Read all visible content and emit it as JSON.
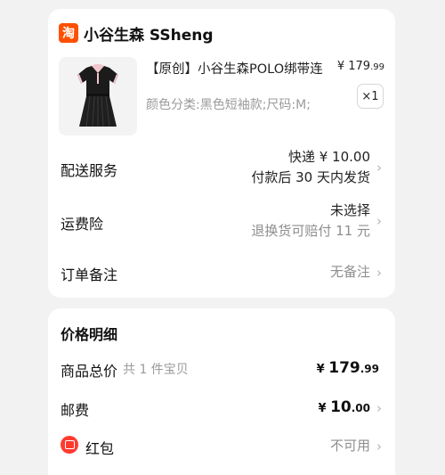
{
  "shop": {
    "logo_glyph": "淘",
    "name": "小谷生森 SSheng"
  },
  "product": {
    "title": "【原创】小谷生森POLO绑带连",
    "price_currency": "¥",
    "price_int": "179",
    "price_dec": ".99",
    "sku": "颜色分类:黑色短袖款;尺码:M;",
    "quantity": "×1",
    "image_icon": "dress-icon"
  },
  "delivery": {
    "label": "配送服务",
    "line1": "快递 ¥ 10.00",
    "line2": "付款后 30 天内发货"
  },
  "insurance": {
    "label": "运费险",
    "line1": "未选择",
    "line2": "退换货可赔付 11 元"
  },
  "remark": {
    "label": "订单备注",
    "value": "无备注"
  },
  "price_detail": {
    "title": "价格明细",
    "goods_total": {
      "label": "商品总价",
      "note": "共 1 件宝贝",
      "currency": "¥",
      "int": "179",
      "dec": ".99"
    },
    "shipping": {
      "label": "邮费",
      "currency": "¥",
      "int": "10",
      "dec": ".00"
    },
    "red_packet": {
      "label": "红包",
      "value": "不可用"
    }
  },
  "colors": {
    "taobao_orange": "#ff5000",
    "red_packet": "#ff3b30",
    "grey_text": "#8e8e8e"
  }
}
